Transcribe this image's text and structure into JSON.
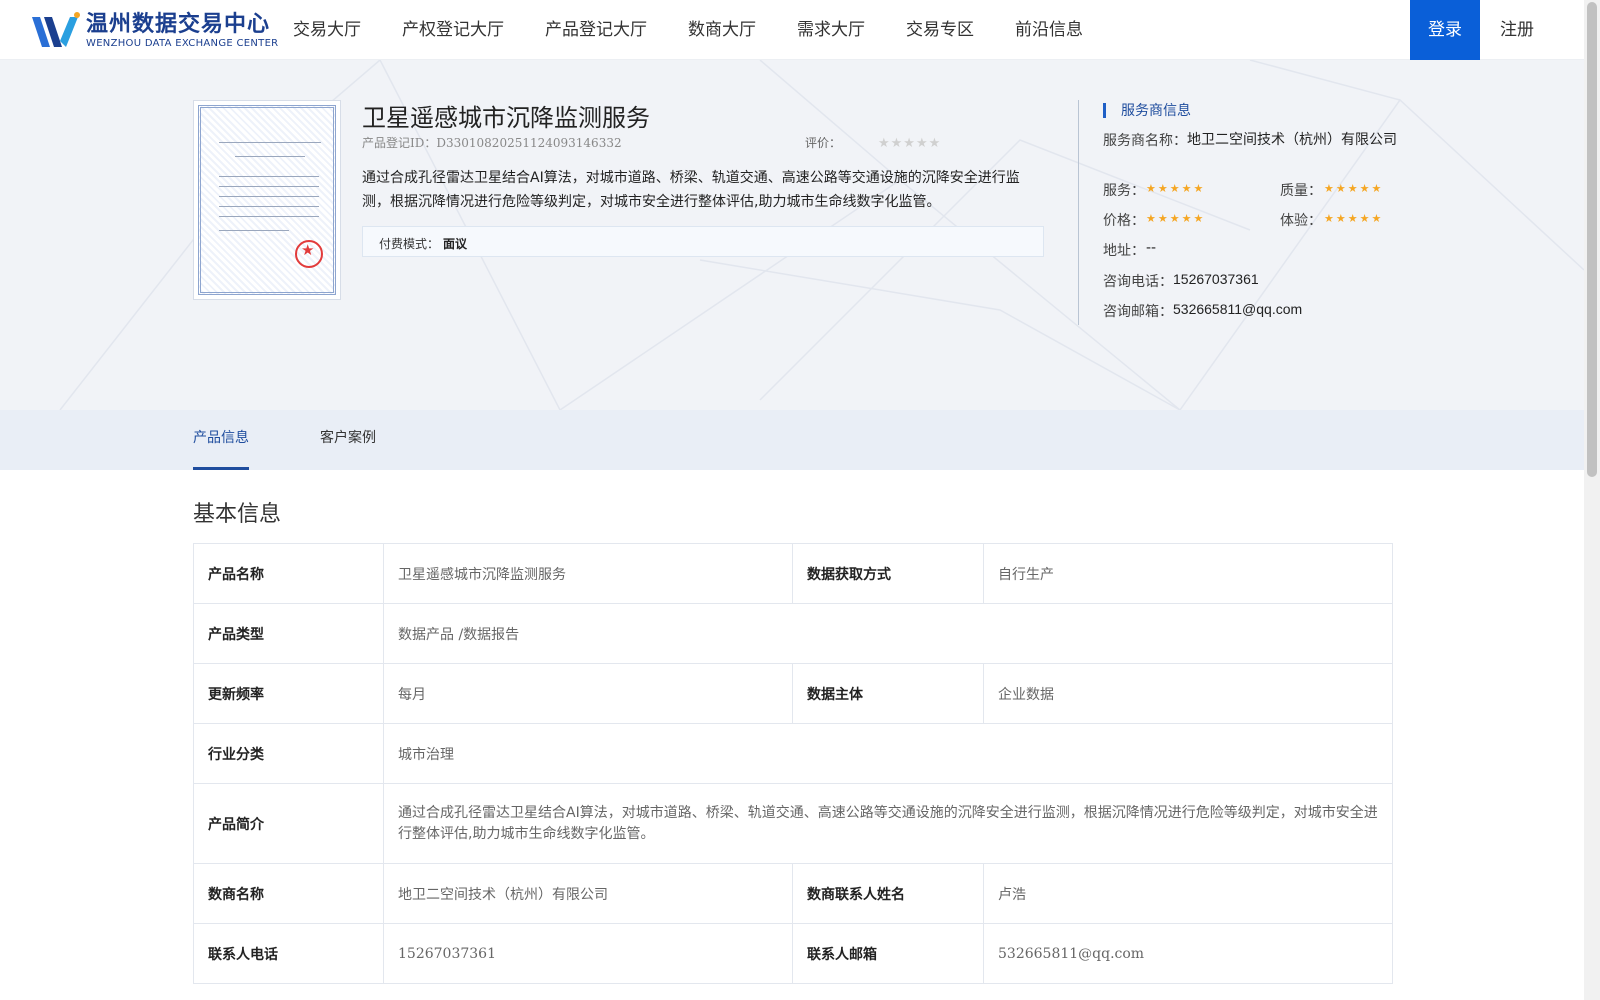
{
  "header": {
    "logo_cn": "温州数据交易中心",
    "logo_en": "WENZHOU DATA EXCHANGE CENTER",
    "nav": [
      "交易大厅",
      "产权登记大厅",
      "产品登记大厅",
      "数商大厅",
      "需求大厅",
      "交易专区",
      "前沿信息"
    ],
    "login_label": "登录",
    "register_label": "注册"
  },
  "product": {
    "title": "卫星遥感城市沉降监测服务",
    "id_label": "产品登记ID：",
    "id_value": "D33010820251124093146332",
    "rating_label": "评价：",
    "rating_stars": "★★★★★",
    "rating_value": 0,
    "description": "通过合成孔径雷达卫星结合AI算法，对城市道路、桥梁、轨道交通、高速公路等交通设施的沉降安全进行监测，根据沉降情况进行危险等级判定，对城市安全进行整体评估,助力城市生命线数字化监管。",
    "pay_label": "付费模式：",
    "pay_value": "面议"
  },
  "provider": {
    "heading": "服务商信息",
    "name_label": "服务商名称：",
    "name_value": "地卫二空间技术（杭州）有限公司",
    "service_label": "服务：",
    "quality_label": "质量：",
    "price_label": "价格：",
    "experience_label": "体验：",
    "stars": "★★★★★",
    "service_rating": 5,
    "quality_rating": 5,
    "price_rating": 5,
    "experience_rating": 5,
    "address_label": "地址：",
    "address_value": "--",
    "phone_label": "咨询电话：",
    "phone_value": "15267037361",
    "email_label": "咨询邮箱：",
    "email_value": "532665811@qq.com"
  },
  "tabs": [
    "产品信息",
    "客户案例"
  ],
  "basic_info": {
    "title": "基本信息",
    "product_name_label": "产品名称",
    "product_name_value": "卫星遥感城市沉降监测服务",
    "data_source_label": "数据获取方式",
    "data_source_value": "自行生产",
    "product_type_label": "产品类型",
    "product_type_value": "数据产品 /数据报告",
    "update_freq_label": "更新频率",
    "update_freq_value": "每月",
    "data_subject_label": "数据主体",
    "data_subject_value": "企业数据",
    "industry_label": "行业分类",
    "industry_value": "城市治理",
    "intro_label": "产品简介",
    "intro_value": "通过合成孔径雷达卫星结合AI算法，对城市道路、桥梁、轨道交通、高速公路等交通设施的沉降安全进行监测，根据沉降情况进行危险等级判定，对城市安全进行整体评估,助力城市生命线数字化监管。",
    "merchant_label": "数商名称",
    "merchant_value": "地卫二空间技术（杭州）有限公司",
    "contact_name_label": "数商联系人姓名",
    "contact_name_value": "卢浩",
    "contact_phone_label": "联系人电话",
    "contact_phone_value": "15267037361",
    "contact_email_label": "联系人邮箱",
    "contact_email_value": "532665811@qq.com"
  },
  "colors": {
    "accent": "#0a5fd8",
    "brand": "#1b3f8f",
    "star": "#f5a623"
  }
}
